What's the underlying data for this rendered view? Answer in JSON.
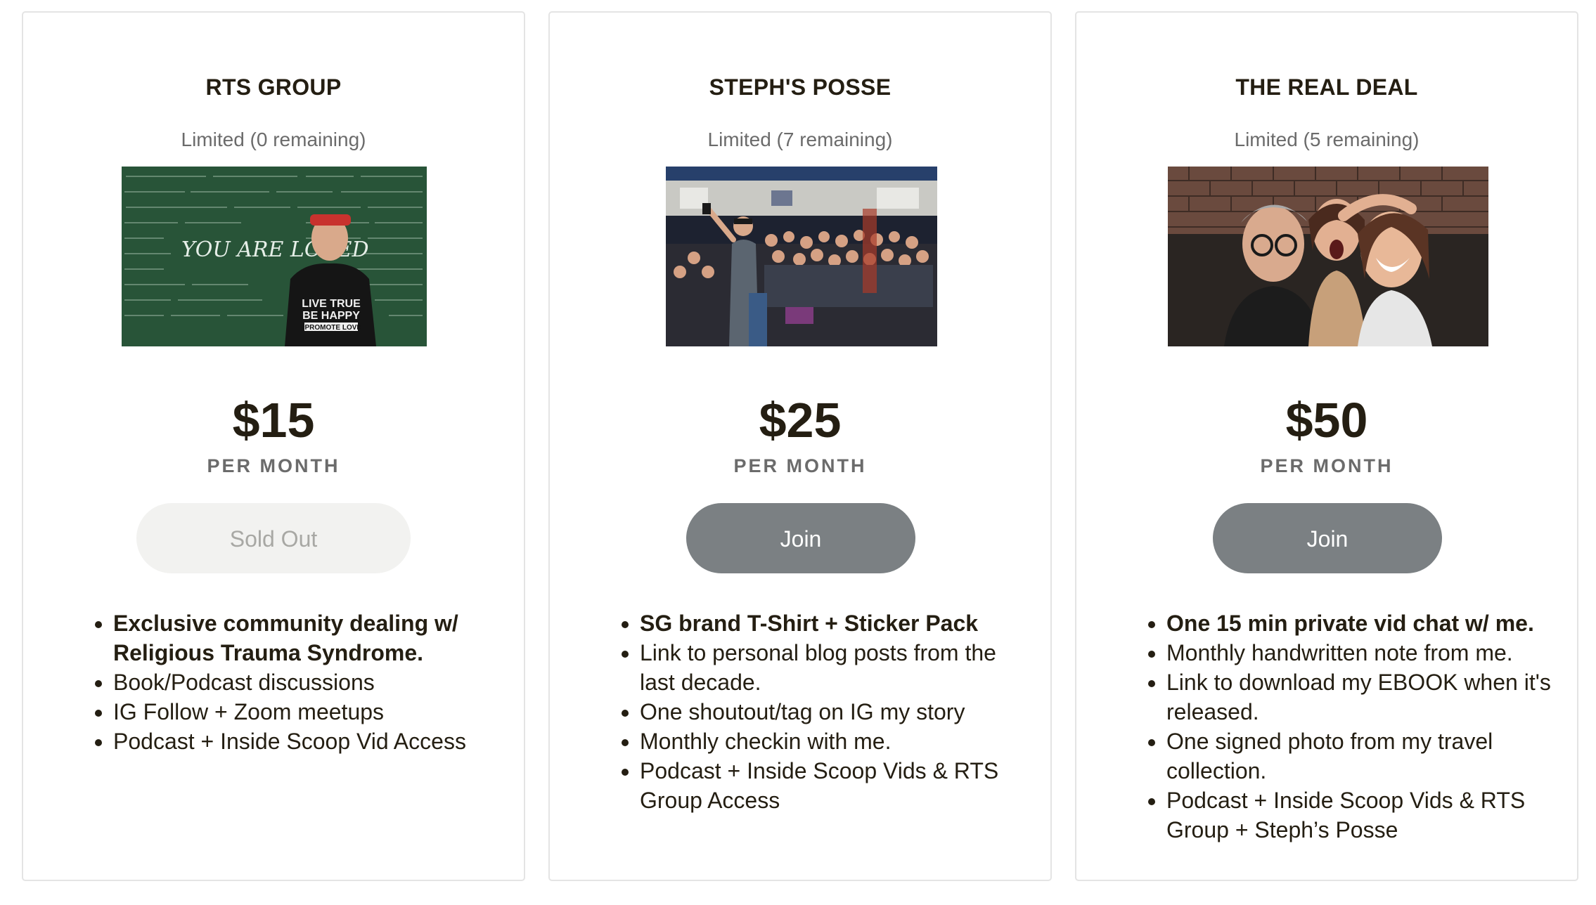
{
  "tiers": [
    {
      "title": "RTS GROUP",
      "limit": "Limited (0 remaining)",
      "price": "$15",
      "period": "PER MONTH",
      "button": "Sold Out",
      "button_state": "disabled",
      "image_text": [
        "YOU ARE LOVED",
        "LIVE TRUE",
        "BE HAPPY",
        "#PROMOTE LOVE"
      ],
      "perks": [
        "Exclusive community dealing w/ Religious Trauma Syndrome.",
        "Book/Podcast discussions",
        "IG Follow + Zoom meetups",
        "Podcast + Inside Scoop Vid Access"
      ]
    },
    {
      "title": "STEPH'S POSSE",
      "limit": "Limited (7 remaining)",
      "price": "$25",
      "period": "PER MONTH",
      "button": "Join",
      "button_state": "enabled",
      "perks": [
        "SG brand T-Shirt + Sticker Pack",
        "Link to personal blog posts from the last decade.",
        "One shoutout/tag on IG my story",
        "Monthly checkin with me.",
        "Podcast + Inside Scoop Vids & RTS Group Access"
      ]
    },
    {
      "title": "THE REAL DEAL",
      "limit": "Limited (5 remaining)",
      "price": "$50",
      "period": "PER MONTH",
      "button": "Join",
      "button_state": "enabled",
      "perks": [
        "One 15 min private vid chat w/ me.",
        "Monthly handwritten note from me.",
        "Link to download my EBOOK when it's released.",
        "One signed photo from my travel collection.",
        "Podcast + Inside Scoop Vids & RTS Group + Steph’s Posse"
      ]
    }
  ],
  "colors": {
    "text": "#241e12",
    "muted": "#6b6b6b",
    "join_button": "#7b8083",
    "sold_out_button": "#f2f2f0",
    "card_border": "#e4e4e4"
  }
}
